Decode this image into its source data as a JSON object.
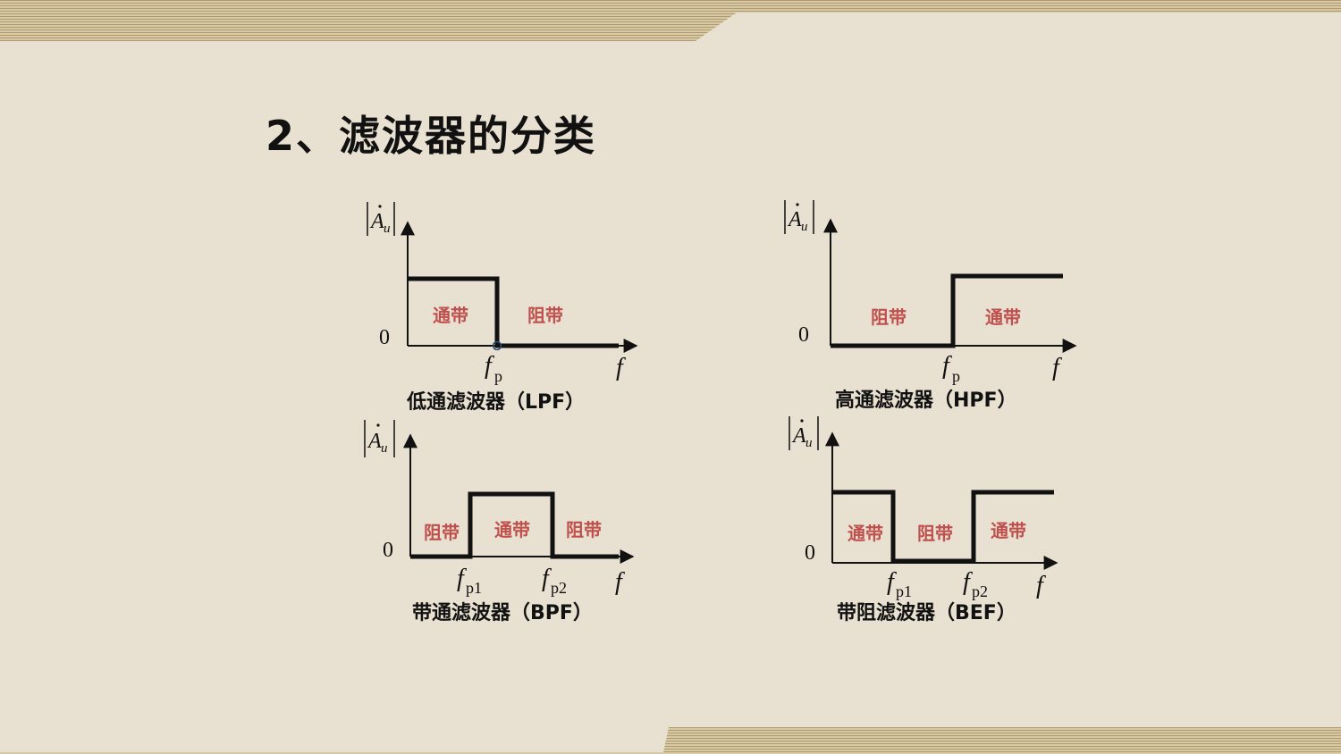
{
  "title": "2、滤波器的分类",
  "axis": {
    "y_symbol": "A",
    "y_subscript": "u",
    "origin": "0",
    "x_symbol": "f",
    "fp_sub": "p",
    "fp1_sub": "p1",
    "fp2_sub": "p2"
  },
  "bands": {
    "pass": "通带",
    "stop": "阻带"
  },
  "filters": {
    "lpf": {
      "caption": "低通滤波器（LPF）"
    },
    "hpf": {
      "caption": "高通滤波器（HPF）"
    },
    "bpf": {
      "caption": "带通滤波器（BPF）"
    },
    "bef": {
      "caption": "带阻滤波器（BEF）"
    }
  },
  "colors": {
    "band_label": "#c0504d",
    "background": "#e8e0d0"
  }
}
